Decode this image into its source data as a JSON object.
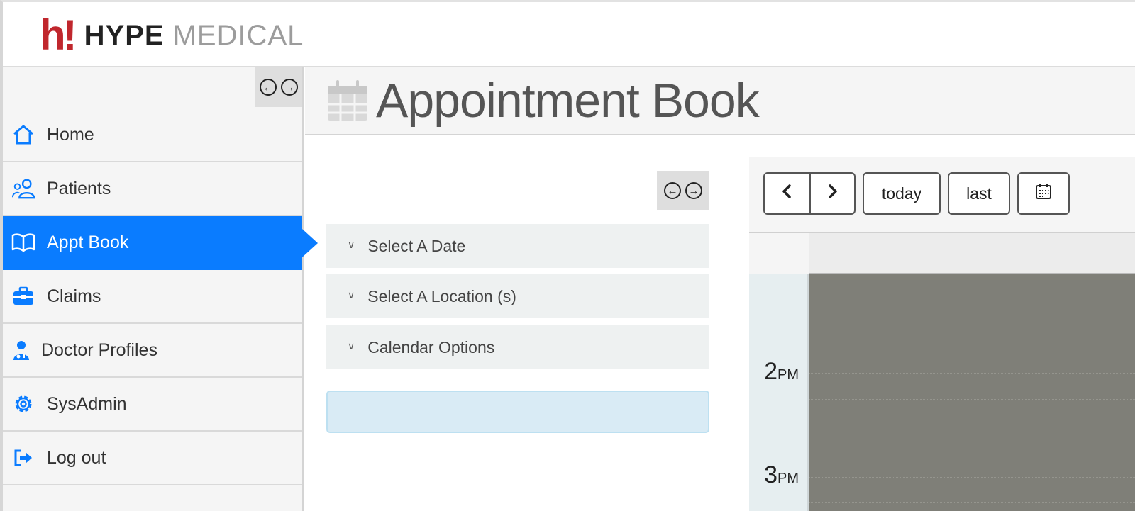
{
  "brand": {
    "mark": "h!",
    "name_a": "HYPE",
    "name_b": "MEDICAL"
  },
  "sidebar": {
    "items": [
      {
        "label": "Home",
        "icon": "home-icon"
      },
      {
        "label": "Patients",
        "icon": "patients-icon"
      },
      {
        "label": "Appt Book",
        "icon": "book-icon",
        "active": true
      },
      {
        "label": "Claims",
        "icon": "briefcase-icon"
      },
      {
        "label": "Doctor Profiles",
        "icon": "doctor-icon"
      },
      {
        "label": "SysAdmin",
        "icon": "gear-icon"
      },
      {
        "label": "Log out",
        "icon": "logout-icon"
      }
    ]
  },
  "page": {
    "title": "Appointment Book",
    "icon": "calendar-icon"
  },
  "filters": {
    "sections": [
      {
        "label": "Select A Date"
      },
      {
        "label": "Select A Location (s)"
      },
      {
        "label": "Calendar Options"
      }
    ]
  },
  "calendar": {
    "today_label": "today",
    "last_label": "last",
    "times": [
      {
        "hour": "2",
        "suffix": "PM"
      },
      {
        "hour": "3",
        "suffix": "PM"
      }
    ]
  },
  "colors": {
    "accent": "#0a7cff",
    "brand_red": "#c0272d",
    "slot_bg": "#7f7f78"
  }
}
